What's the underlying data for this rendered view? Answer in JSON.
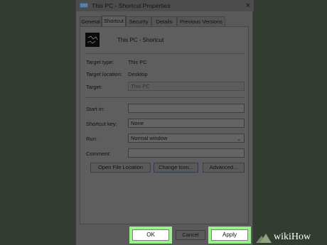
{
  "window": {
    "title": "This PC - Shortcut Properties",
    "close_glyph": "×"
  },
  "tabs": [
    {
      "label": "General"
    },
    {
      "label": "Shortcut"
    },
    {
      "label": "Security"
    },
    {
      "label": "Details"
    },
    {
      "label": "Previous Versions"
    }
  ],
  "header": {
    "name": "This PC - Shortcut"
  },
  "info": {
    "target_type_label": "Target type:",
    "target_type_value": "This PC",
    "target_location_label": "Target location:",
    "target_location_value": "Desktop",
    "target_label": "Target:",
    "target_value": "This PC"
  },
  "form": {
    "start_in_label": "Start in:",
    "start_in_value": "",
    "shortcut_key_label": "Shortcut key:",
    "shortcut_key_value": "None",
    "run_label": "Run:",
    "run_value": "Normal window",
    "comment_label": "Comment:",
    "comment_value": ""
  },
  "actions": {
    "open_file_location": "Open File Location",
    "change_icon": "Change Icon...",
    "advanced": "Advanced..."
  },
  "footer": {
    "ok": "OK",
    "cancel": "Cancel",
    "apply": "Apply"
  },
  "watermark": {
    "text": "wikiHow"
  },
  "colors": {
    "highlight": "#9af08a",
    "background": "#323c30"
  }
}
